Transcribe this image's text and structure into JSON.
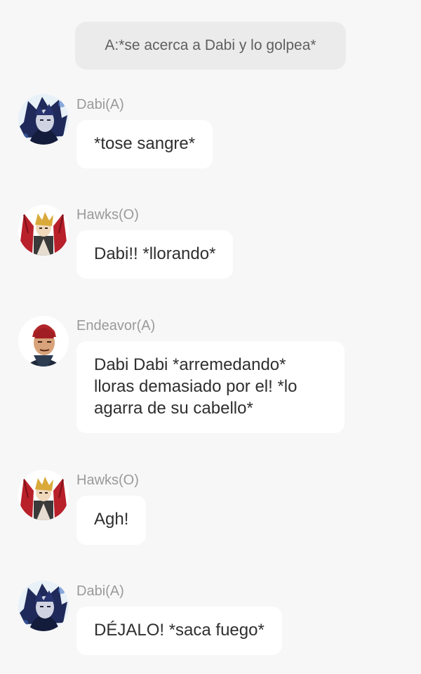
{
  "narration": "A:*se acerca a Dabi y lo golpea*",
  "messages": [
    {
      "sender": "Dabi(A)",
      "text": "*tose sangre*",
      "avatar": "dabi-avatar"
    },
    {
      "sender": "Hawks(O)",
      "text": "Dabi!! *llorando*",
      "avatar": "hawks-avatar"
    },
    {
      "sender": "Endeavor(A)",
      "text": "Dabi Dabi *arremedando* lloras demasiado por el! *lo agarra de su cabello*",
      "avatar": "endeavor-avatar"
    },
    {
      "sender": "Hawks(O)",
      "text": "Agh!",
      "avatar": "hawks-avatar"
    },
    {
      "sender": "Dabi(A)",
      "text": "DÉJALO! *saca fuego*",
      "avatar": "dabi-avatar"
    }
  ]
}
